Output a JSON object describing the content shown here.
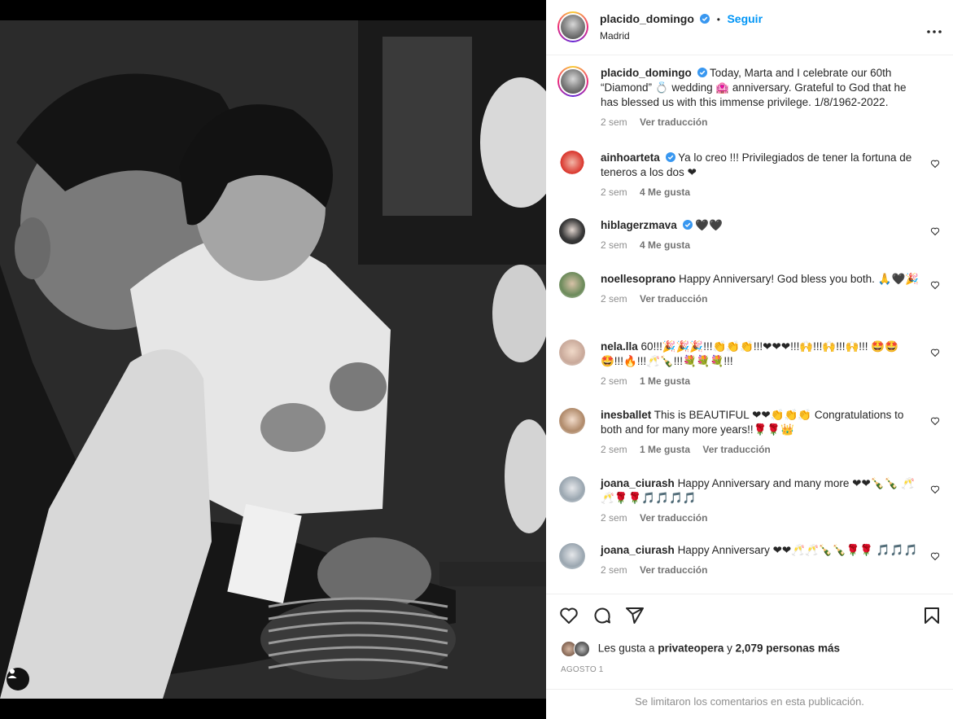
{
  "post": {
    "author": "placido_domingo",
    "follow_label": "Seguir",
    "separator": "•",
    "location": "Madrid",
    "more": "•••",
    "caption": "Today, Marta and I celebrate our 60th “Diamond” 💍 wedding 🏩 anniversary. Grateful to God that he has blessed us with this immense privilege. 1/8/1962-2022.",
    "caption_time": "2 sem",
    "caption_translate": "Ver traducción"
  },
  "comments": [
    {
      "user": "ainhoarteta",
      "verified": true,
      "text": "Ya lo creo !!! Privilegiados de tener la fortuna de teneros a los dos ❤",
      "time": "2 sem",
      "likes": "4 Me gusta",
      "translate": "",
      "avatar_color": "#d9342b"
    },
    {
      "user": "hiblagerzmava",
      "verified": true,
      "text": "🖤🖤",
      "time": "2 sem",
      "likes": "4 Me gusta",
      "translate": "",
      "avatar_color": "#1a1a1a"
    },
    {
      "user": "noellesoprano",
      "verified": false,
      "text": "Happy Anniversary! God bless you both. 🙏🖤🎉",
      "time": "2 sem",
      "likes": "",
      "translate": "Ver traducción",
      "avatar_color": "#6b8a5a"
    },
    {
      "user": "nela.lla",
      "verified": false,
      "text": "60!!!🎉🎉🎉!!!👏👏👏!!!❤❤❤!!!🙌!!!🙌!!!🙌!!! 🤩🤩🤩!!!🔥!!!🥂🍾!!!💐💐💐!!!",
      "time": "2 sem",
      "likes": "1 Me gusta",
      "translate": "",
      "avatar_color": "#c9a99a"
    },
    {
      "user": "inesballet",
      "verified": false,
      "text": "This is BEAUTIFUL ❤❤👏👏👏 Congratulations to both and for many more years!!🌹🌹👑",
      "time": "2 sem",
      "likes": "1 Me gusta",
      "translate": "Ver traducción",
      "avatar_color": "#b08a6a"
    },
    {
      "user": "joana_ciurash",
      "verified": false,
      "text": "Happy Anniversary and many more ❤❤🍾🍾 🥂🥂🌹🌹🎵🎵🎵🎵",
      "time": "2 sem",
      "likes": "",
      "translate": "Ver traducción",
      "avatar_color": "#9aa6b0"
    },
    {
      "user": "joana_ciurash",
      "verified": false,
      "text": "Happy Anniversary ❤❤🥂🥂🍾🍾🌹🌹 🎵🎵🎵",
      "time": "2 sem",
      "likes": "",
      "translate": "Ver traducción",
      "avatar_color": "#9aa6b0"
    }
  ],
  "footer": {
    "liked_prefix": "Les gusta a",
    "liked_user": "privateopera",
    "liked_and": "y",
    "liked_others": "2,079 personas más",
    "date": "AGOSTO 1",
    "limited_notice": "Se limitaron los comentarios en esta publicación."
  },
  "icons": {
    "like": "heart-icon",
    "comment": "comment-icon",
    "share": "share-icon",
    "save": "bookmark-icon",
    "tag": "user-tag-icon"
  },
  "colors": {
    "accent": "#0095f6",
    "verified": "#3897f0",
    "muted": "#8e8e8e"
  }
}
